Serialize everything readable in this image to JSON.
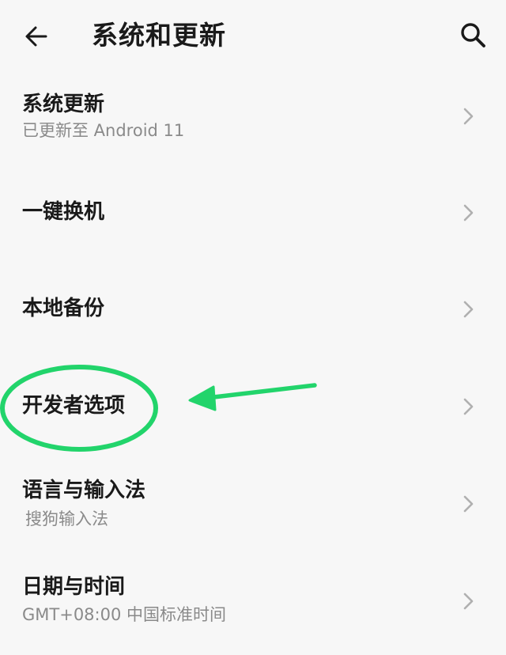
{
  "header": {
    "title": "系统和更新",
    "back_icon": "arrow-left-icon",
    "search_icon": "search-icon"
  },
  "items": [
    {
      "title": "系统更新",
      "subtitle": "已更新至 Android 11"
    },
    {
      "title": "一键换机",
      "subtitle": ""
    },
    {
      "title": "本地备份",
      "subtitle": ""
    },
    {
      "title": "开发者选项",
      "subtitle": ""
    },
    {
      "title": "语言与输入法",
      "subtitle": "搜狗输入法"
    },
    {
      "title": "日期与时间",
      "subtitle": "GMT+08:00 中国标准时间"
    }
  ],
  "colors": {
    "background": "#f7f7f7",
    "text": "#1a1a1a",
    "subtext": "#8a8a8a",
    "chevron": "#b0b0b0",
    "annotation": "#22d46b"
  }
}
